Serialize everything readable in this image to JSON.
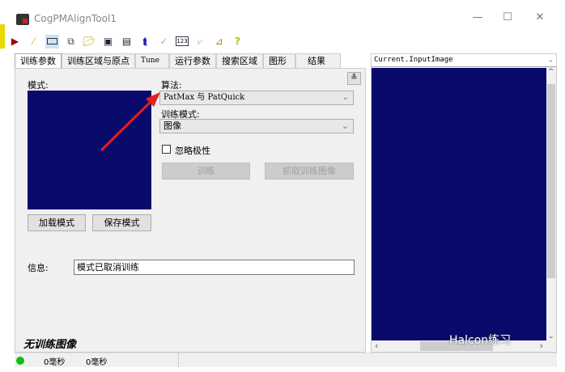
{
  "window": {
    "title": "CogPMAlignTool1",
    "minimize": "—",
    "maximize": "☐",
    "close": "✕"
  },
  "toolbar": {
    "icons": [
      "run-icon",
      "edit-icon",
      "view-icon",
      "copy-icon",
      "open-icon",
      "save-icon",
      "save-as-icon",
      "reset-icon",
      "pin-icon",
      "numeric-icon",
      "graph-icon",
      "tool-icon",
      "help-icon"
    ]
  },
  "tabs": [
    "训练参数",
    "训练区域与原点",
    "Tune",
    "运行参数",
    "搜索区域",
    "图形",
    "结果"
  ],
  "train_params": {
    "model_label": "模式:",
    "load_button": "加载模式",
    "save_button": "保存模式",
    "algorithm_label": "算法:",
    "algorithm_value": "PatMax 与 PatQuick",
    "train_mode_label": "训练模式:",
    "train_mode_value": "图像",
    "ignore_polarity_label": "忽略极性",
    "ignore_polarity_checked": false,
    "train_button": "训练",
    "grab_button": "抓取训练图像",
    "expand_glyph": "≚",
    "info_label": "信息:",
    "info_value": "模式已取消训练",
    "untrained_text": "无训练图像"
  },
  "image_view": {
    "selected_image": "Current.InputImage"
  },
  "status": {
    "time1": "0毫秒",
    "time2": "0毫秒"
  },
  "watermark": "Halcon练习",
  "colors": {
    "image_bg": "#0a0a6c",
    "arrow": "#e02020",
    "status_ok": "#10c010"
  }
}
